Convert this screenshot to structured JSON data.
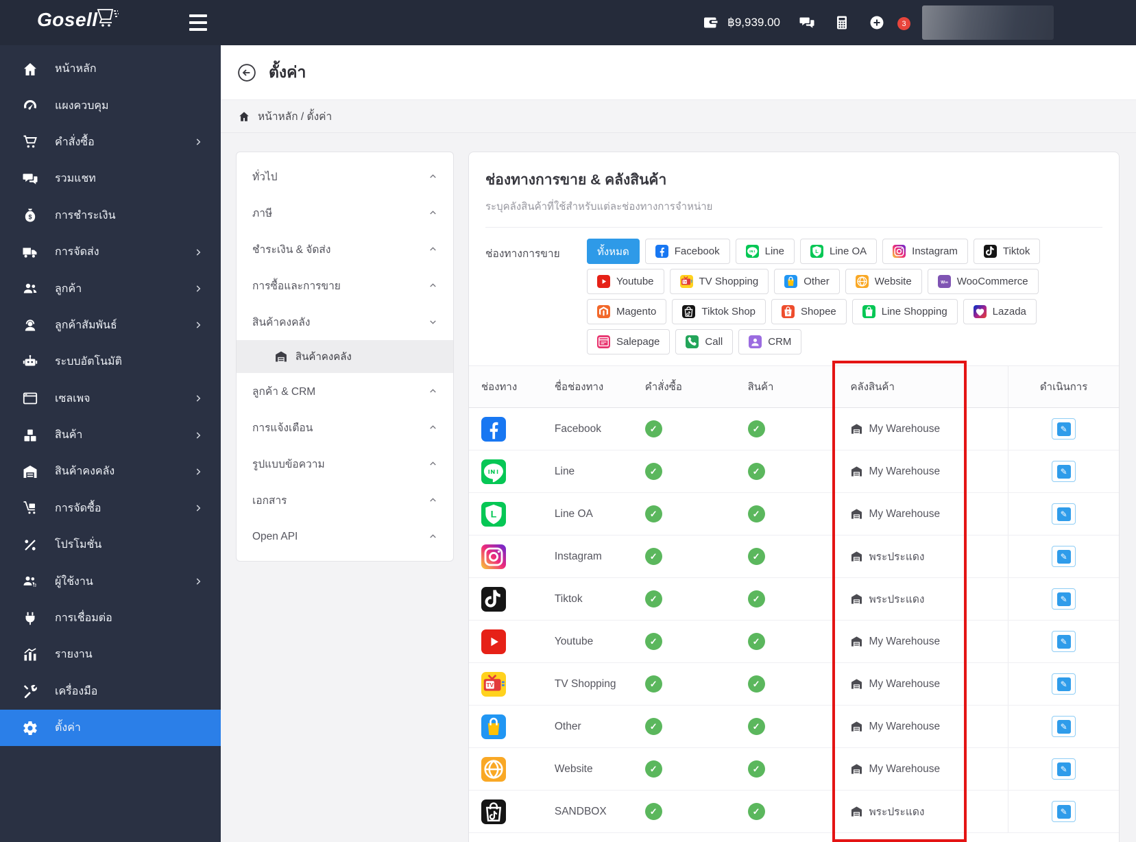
{
  "topbar": {
    "logo_text": "Gosell",
    "balance": "฿9,939.00",
    "notification_badge": "3",
    "icons": [
      "hamburger-icon",
      "wallet-icon",
      "chat-icon",
      "calculator-icon",
      "add-circle-icon",
      "bell-icon"
    ]
  },
  "colors": {
    "topbar_bg": "#252b3a",
    "sidebar_bg": "#2a3143",
    "sidebar_active_blue": "#2b7fe8",
    "filter_active_blue": "#2e9ae8",
    "success_green": "#5bb75d",
    "annotation_red": "#e41414"
  },
  "sidebar": {
    "items": [
      {
        "label": "หน้าหลัก",
        "icon": "home",
        "chevron": false,
        "active": false
      },
      {
        "label": "แผงควบคุม",
        "icon": "dashboard",
        "chevron": false,
        "active": false
      },
      {
        "label": "คำสั่งซื้อ",
        "icon": "cart",
        "chevron": true,
        "active": false
      },
      {
        "label": "รวมแชท",
        "icon": "chat",
        "chevron": false,
        "active": false
      },
      {
        "label": "การชำระเงิน",
        "icon": "payment",
        "chevron": false,
        "active": false
      },
      {
        "label": "การจัดส่ง",
        "icon": "shipping",
        "chevron": true,
        "active": false
      },
      {
        "label": "ลูกค้า",
        "icon": "customers",
        "chevron": true,
        "active": false
      },
      {
        "label": "ลูกค้าสัมพันธ์",
        "icon": "crm",
        "chevron": true,
        "active": false
      },
      {
        "label": "ระบบอัตโนมัติ",
        "icon": "automation",
        "chevron": false,
        "active": false
      },
      {
        "label": "เซลเพจ",
        "icon": "browser",
        "chevron": true,
        "active": false
      },
      {
        "label": "สินค้า",
        "icon": "products",
        "chevron": true,
        "active": false
      },
      {
        "label": "สินค้าคงคลัง",
        "icon": "warehouse",
        "chevron": true,
        "active": false
      },
      {
        "label": "การจัดซื้อ",
        "icon": "purchase",
        "chevron": true,
        "active": false
      },
      {
        "label": "โปรโมชั่น",
        "icon": "promotion",
        "chevron": false,
        "active": false
      },
      {
        "label": "ผู้ใช้งาน",
        "icon": "users",
        "chevron": true,
        "active": false
      },
      {
        "label": "การเชื่อมต่อ",
        "icon": "plug",
        "chevron": false,
        "active": false
      },
      {
        "label": "รายงาน",
        "icon": "report",
        "chevron": false,
        "active": false
      },
      {
        "label": "เครื่องมือ",
        "icon": "tools",
        "chevron": false,
        "active": false
      },
      {
        "label": "ตั้งค่า",
        "icon": "gear",
        "chevron": false,
        "active": true
      }
    ]
  },
  "page": {
    "title": "ตั้งค่า",
    "breadcrumb": "หน้าหลัก / ตั้งค่า"
  },
  "settings_menu": {
    "items": [
      {
        "label": "ทั่วไป",
        "state": "collapsed"
      },
      {
        "label": "ภาษี",
        "state": "collapsed"
      },
      {
        "label": "ชำระเงิน & จัดส่ง",
        "state": "collapsed"
      },
      {
        "label": "การซื้อและการขาย",
        "state": "collapsed"
      },
      {
        "label": "สินค้าคงคลัง",
        "state": "expanded",
        "children": [
          {
            "label": "สินค้าคงคลัง",
            "icon": "warehouse",
            "active": true
          }
        ]
      },
      {
        "label": "ลูกค้า & CRM",
        "state": "collapsed"
      },
      {
        "label": "การแจ้งเตือน",
        "state": "collapsed"
      },
      {
        "label": "รูปแบบข้อความ",
        "state": "collapsed"
      },
      {
        "label": "เอกสาร",
        "state": "collapsed"
      },
      {
        "label": "Open API",
        "state": "collapsed"
      }
    ]
  },
  "main_panel": {
    "title": "ช่องทางการขาย & คลังสินค้า",
    "subtitle": "ระบุคลังสินค้าที่ใช้สำหรับแต่ละช่องทางการจำหน่าย",
    "filter_label": "ช่องทางการขาย",
    "filter_rows": [
      [
        {
          "label": "ทั้งหมด",
          "icon": null,
          "active": true
        },
        {
          "label": "Facebook",
          "icon": "facebook",
          "active": false
        },
        {
          "label": "Line",
          "icon": "line",
          "active": false
        },
        {
          "label": "Line OA",
          "icon": "line-oa",
          "active": false
        },
        {
          "label": "Instagram",
          "icon": "instagram",
          "active": false
        },
        {
          "label": "Tiktok",
          "icon": "tiktok",
          "active": false
        }
      ],
      [
        {
          "label": "Youtube",
          "icon": "youtube",
          "active": false
        },
        {
          "label": "TV Shopping",
          "icon": "tv-shopping",
          "active": false
        },
        {
          "label": "Other",
          "icon": "other",
          "active": false
        },
        {
          "label": "Website",
          "icon": "website",
          "active": false
        },
        {
          "label": "WooCommerce",
          "icon": "woocommerce",
          "active": false
        }
      ],
      [
        {
          "label": "Magento",
          "icon": "magento",
          "active": false
        },
        {
          "label": "Tiktok Shop",
          "icon": "tiktok-shop",
          "active": false
        },
        {
          "label": "Shopee",
          "icon": "shopee",
          "active": false
        },
        {
          "label": "Line Shopping",
          "icon": "line-shopping",
          "active": false
        },
        {
          "label": "Lazada",
          "icon": "lazada",
          "active": false
        }
      ],
      [
        {
          "label": "Salepage",
          "icon": "salepage-ch",
          "active": false
        },
        {
          "label": "Call",
          "icon": "call",
          "active": false
        },
        {
          "label": "CRM",
          "icon": "crm-ch",
          "active": false
        }
      ]
    ],
    "table": {
      "headers": [
        "ช่องทาง",
        "ชื่อช่องทาง",
        "คำสั่งซื้อ",
        "สินค้า",
        "คลังสินค้า",
        "ดำเนินการ"
      ],
      "rows": [
        {
          "icon": "facebook",
          "name": "Facebook",
          "order_ok": true,
          "product_ok": true,
          "warehouse": "My Warehouse"
        },
        {
          "icon": "line",
          "name": "Line",
          "order_ok": true,
          "product_ok": true,
          "warehouse": "My Warehouse"
        },
        {
          "icon": "line-oa",
          "name": "Line OA",
          "order_ok": true,
          "product_ok": true,
          "warehouse": "My Warehouse"
        },
        {
          "icon": "instagram",
          "name": "Instagram",
          "order_ok": true,
          "product_ok": true,
          "warehouse": "พระประแดง"
        },
        {
          "icon": "tiktok",
          "name": "Tiktok",
          "order_ok": true,
          "product_ok": true,
          "warehouse": "พระประแดง"
        },
        {
          "icon": "youtube",
          "name": "Youtube",
          "order_ok": true,
          "product_ok": true,
          "warehouse": "My Warehouse"
        },
        {
          "icon": "tv-shopping",
          "name": "TV Shopping",
          "order_ok": true,
          "product_ok": true,
          "warehouse": "My Warehouse"
        },
        {
          "icon": "other",
          "name": "Other",
          "order_ok": true,
          "product_ok": true,
          "warehouse": "My Warehouse"
        },
        {
          "icon": "website",
          "name": "Website",
          "order_ok": true,
          "product_ok": true,
          "warehouse": "My Warehouse"
        },
        {
          "icon": "tiktok-shop",
          "name": "SANDBOX",
          "order_ok": true,
          "product_ok": true,
          "warehouse": "พระประแดง"
        }
      ]
    }
  }
}
